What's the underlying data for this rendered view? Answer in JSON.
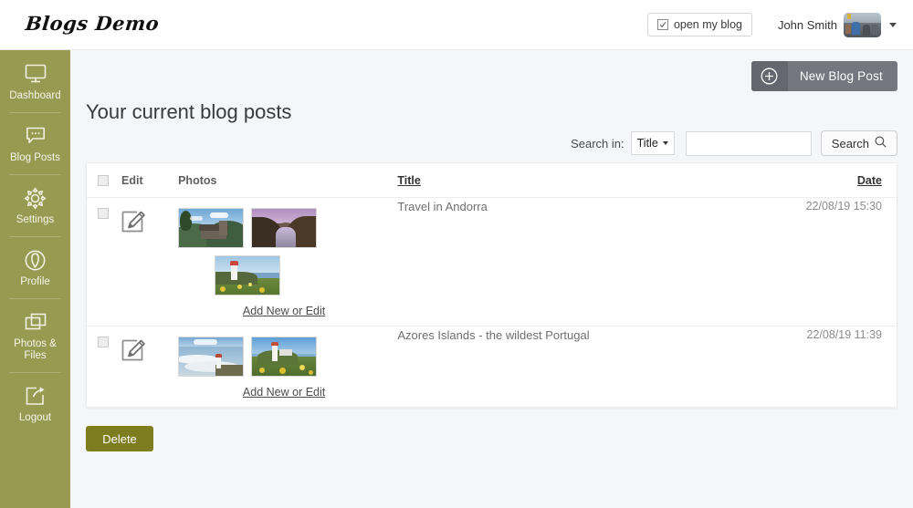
{
  "header": {
    "logo": "Blogs Demo",
    "open_blog_label": "open my blog",
    "open_blog_icon": "window-check-icon",
    "user_name": "John Smith",
    "avatar_icon": "user-avatar",
    "user_caret_icon": "chevron-down-icon"
  },
  "sidebar": {
    "items": [
      {
        "label": "Dashboard",
        "icon": "monitor-icon"
      },
      {
        "label": "Blog Posts",
        "icon": "speech-bubble-icon"
      },
      {
        "label": "Settings",
        "icon": "gear-icon"
      },
      {
        "label": "Profile",
        "icon": "person-circle-icon"
      },
      {
        "label": "Photos & Files",
        "icon": "stacked-windows-icon"
      },
      {
        "label": "Logout",
        "icon": "exit-arrow-icon"
      }
    ]
  },
  "main": {
    "new_post_label": "New Blog Post",
    "new_post_icon": "plus-circle-icon",
    "page_title": "Your current blog posts",
    "search": {
      "label": "Search in:",
      "select_value": "Title",
      "select_options": [
        "Title"
      ],
      "input_value": "",
      "input_placeholder": "",
      "button_label": "Search",
      "button_icon": "magnifier-icon"
    },
    "table": {
      "headers": {
        "check": "",
        "edit": "Edit",
        "photos": "Photos",
        "title": "Title",
        "date": "Date"
      },
      "rows": [
        {
          "edit_icon": "pencil-edit-icon",
          "photos": [
            {
              "alt": "stone church on green hillside",
              "art": "ph-church"
            },
            {
              "alt": "purple mountain valley with stream",
              "art": "ph-valley"
            },
            {
              "alt": "lighthouse above yellow flowers",
              "art": "ph-lighthouse"
            }
          ],
          "add_link": "Add New or Edit",
          "title": "Travel in Andorra",
          "date": "22/08/19 15:30"
        },
        {
          "edit_icon": "pencil-edit-icon",
          "photos": [
            {
              "alt": "ocean waves by a small lighthouse",
              "art": "ph-waves"
            },
            {
              "alt": "lighthouse on a green cliff",
              "art": "ph-cliff"
            }
          ],
          "add_link": "Add New or Edit",
          "title": "Azores Islands - the wildest Portugal",
          "date": "22/08/19 11:39"
        }
      ]
    },
    "delete_label": "Delete"
  },
  "colors": {
    "sidebar": "#989a52",
    "delete_button": "#7d7d20",
    "new_post_button": "#75767f",
    "page_background": "#f4f6f9"
  }
}
